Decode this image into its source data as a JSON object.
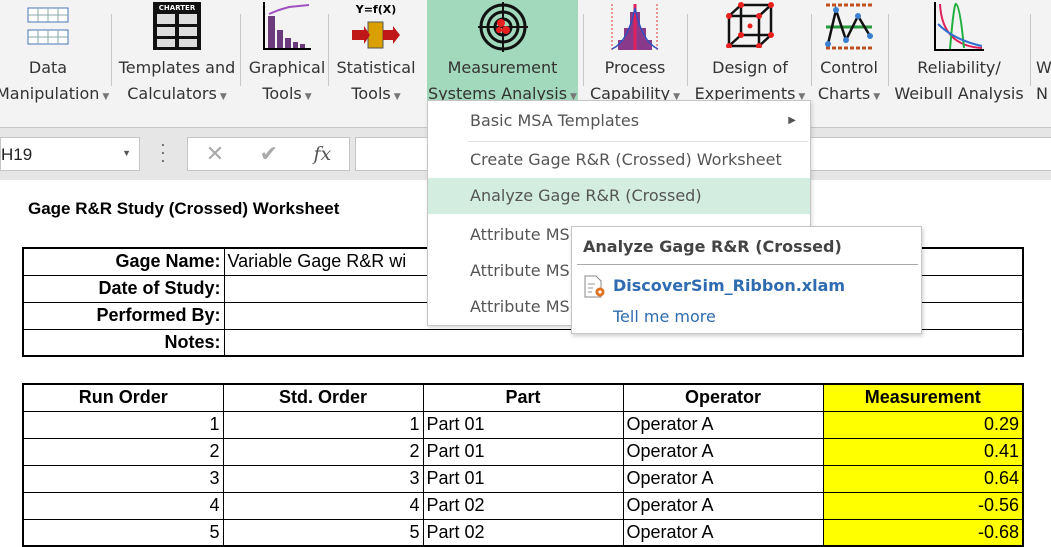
{
  "ribbon": {
    "groups": [
      {
        "l1": "Data",
        "l2": "Manipulation",
        "icon": "table-grid-icon"
      },
      {
        "l1": "Templates and",
        "l2": "Calculators",
        "icon": "charter-template-icon",
        "icon_text": "CHARTER"
      },
      {
        "l1": "Graphical",
        "l2": "Tools",
        "icon": "pareto-chart-icon"
      },
      {
        "l1": "Statistical",
        "l2": "Tools",
        "icon": "transfer-function-icon",
        "icon_text": "Y=f(X)"
      },
      {
        "l1": "Measurement",
        "l2": "Systems Analysis",
        "icon": "target-icon"
      },
      {
        "l1": "Process",
        "l2": "Capability",
        "icon": "histogram-icon"
      },
      {
        "l1": "Design of",
        "l2": "Experiments",
        "icon": "cube-icon"
      },
      {
        "l1": "Control",
        "l2": "Charts",
        "icon": "control-chart-icon"
      },
      {
        "l1": "Reliability/",
        "l2": "Weibull Analysis",
        "icon": "weibull-icon"
      },
      {
        "l1": "W",
        "l2": "N"
      }
    ],
    "active_color": "#a2d8bb"
  },
  "formula_bar": {
    "name_box": "H19",
    "cancel": "✕",
    "enter": "✔",
    "fx": "fx",
    "value": ""
  },
  "sheet": {
    "title": "Gage R&R Study (Crossed) Worksheet",
    "info": [
      {
        "label": "Gage Name:",
        "value": "Variable Gage R&R wi"
      },
      {
        "label": "Date of Study:",
        "value": ""
      },
      {
        "label": "Performed By:",
        "value": ""
      },
      {
        "label": "Notes:",
        "value": ""
      }
    ],
    "columns": [
      "Run Order",
      "Std. Order",
      "Part",
      "Operator",
      "Measurement"
    ],
    "rows": [
      [
        "1",
        "1",
        "Part 01",
        "Operator A",
        "0.29"
      ],
      [
        "2",
        "2",
        "Part 01",
        "Operator A",
        "0.41"
      ],
      [
        "3",
        "3",
        "Part 01",
        "Operator A",
        "0.64"
      ],
      [
        "4",
        "4",
        "Part 02",
        "Operator A",
        "-0.56"
      ],
      [
        "5",
        "5",
        "Part 02",
        "Operator A",
        "-0.68"
      ]
    ],
    "highlight_color": "#ffff00"
  },
  "menu": {
    "items": [
      "Basic MSA Templates",
      "Create Gage R&R (Crossed) Worksheet",
      "Analyze Gage R&R (Crossed)",
      "Attribute MS",
      "Attribute MS",
      "Attribute MS"
    ],
    "highlight_color": "#d3ede0"
  },
  "tooltip": {
    "title": "Analyze Gage R&R (Crossed)",
    "file": "DiscoverSim_Ribbon.xlam",
    "more": "Tell me more"
  }
}
